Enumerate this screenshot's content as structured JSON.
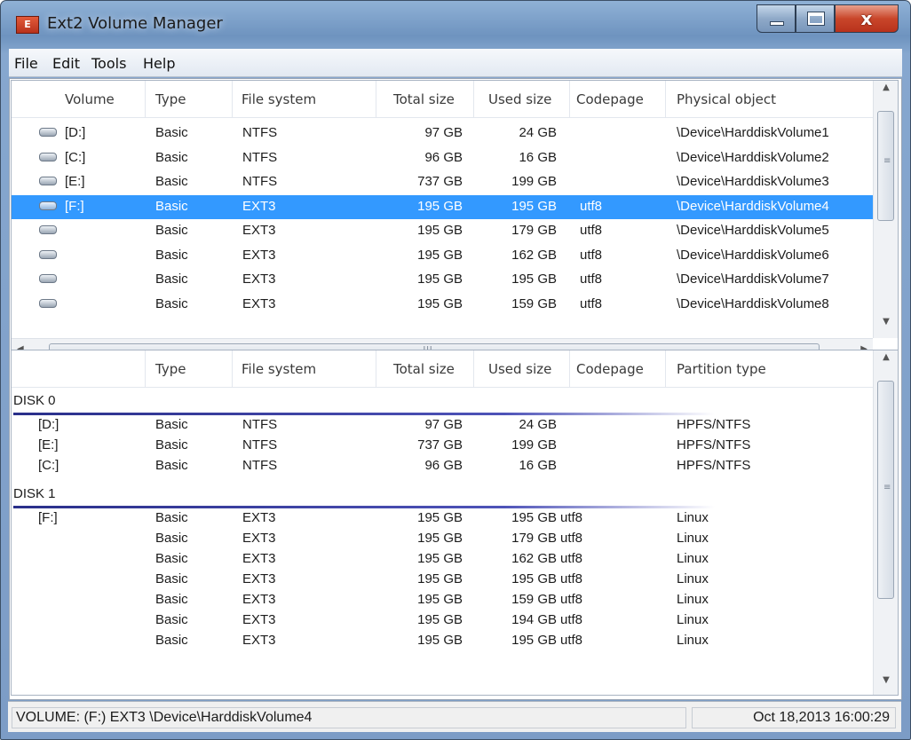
{
  "window": {
    "title": "Ext2 Volume Manager",
    "icon": "ext2-app-icon",
    "buttons": [
      "minimize",
      "maximize",
      "close"
    ],
    "close_glyph": "x"
  },
  "menu": [
    "File",
    "Edit",
    "Tools",
    "Help"
  ],
  "volumes": {
    "headers": [
      "Volume",
      "Type",
      "File system",
      "Total size",
      "Used size",
      "Codepage",
      "Physical object"
    ],
    "rows": [
      {
        "volume": "[D:]",
        "type": "Basic",
        "fs": "NTFS",
        "total": "97 GB",
        "used": "24 GB",
        "codepage": "",
        "physical": "\\Device\\HarddiskVolume1",
        "selected": false
      },
      {
        "volume": "[C:]",
        "type": "Basic",
        "fs": "NTFS",
        "total": "96 GB",
        "used": "16 GB",
        "codepage": "",
        "physical": "\\Device\\HarddiskVolume2",
        "selected": false
      },
      {
        "volume": "[E:]",
        "type": "Basic",
        "fs": "NTFS",
        "total": "737 GB",
        "used": "199 GB",
        "codepage": "",
        "physical": "\\Device\\HarddiskVolume3",
        "selected": false
      },
      {
        "volume": "[F:]",
        "type": "Basic",
        "fs": "EXT3",
        "total": "195 GB",
        "used": "195 GB",
        "codepage": "utf8",
        "physical": "\\Device\\HarddiskVolume4",
        "selected": true
      },
      {
        "volume": "",
        "type": "Basic",
        "fs": "EXT3",
        "total": "195 GB",
        "used": "179 GB",
        "codepage": "utf8",
        "physical": "\\Device\\HarddiskVolume5",
        "selected": false
      },
      {
        "volume": "",
        "type": "Basic",
        "fs": "EXT3",
        "total": "195 GB",
        "used": "162 GB",
        "codepage": "utf8",
        "physical": "\\Device\\HarddiskVolume6",
        "selected": false
      },
      {
        "volume": "",
        "type": "Basic",
        "fs": "EXT3",
        "total": "195 GB",
        "used": "195 GB",
        "codepage": "utf8",
        "physical": "\\Device\\HarddiskVolume7",
        "selected": false
      },
      {
        "volume": "",
        "type": "Basic",
        "fs": "EXT3",
        "total": "195 GB",
        "used": "159 GB",
        "codepage": "utf8",
        "physical": "\\Device\\HarddiskVolume8",
        "selected": false
      }
    ]
  },
  "disks": {
    "headers": [
      "Type",
      "File system",
      "Total size",
      "Used size",
      "Codepage",
      "Partition type"
    ],
    "groups": [
      {
        "label": "DISK 0",
        "rows": [
          {
            "volume": "[D:]",
            "type": "Basic",
            "fs": "NTFS",
            "total": "97 GB",
            "used": "24 GB",
            "codepage": "",
            "partition": "HPFS/NTFS"
          },
          {
            "volume": "[E:]",
            "type": "Basic",
            "fs": "NTFS",
            "total": "737 GB",
            "used": "199 GB",
            "codepage": "",
            "partition": "HPFS/NTFS"
          },
          {
            "volume": "[C:]",
            "type": "Basic",
            "fs": "NTFS",
            "total": "96 GB",
            "used": "16 GB",
            "codepage": "",
            "partition": "HPFS/NTFS"
          }
        ]
      },
      {
        "label": "DISK 1",
        "rows": [
          {
            "volume": "[F:]",
            "type": "Basic",
            "fs": "EXT3",
            "total": "195 GB",
            "used": "195 GB",
            "codepage": "utf8",
            "partition": "Linux"
          },
          {
            "volume": "",
            "type": "Basic",
            "fs": "EXT3",
            "total": "195 GB",
            "used": "179 GB",
            "codepage": "utf8",
            "partition": "Linux"
          },
          {
            "volume": "",
            "type": "Basic",
            "fs": "EXT3",
            "total": "195 GB",
            "used": "162 GB",
            "codepage": "utf8",
            "partition": "Linux"
          },
          {
            "volume": "",
            "type": "Basic",
            "fs": "EXT3",
            "total": "195 GB",
            "used": "195 GB",
            "codepage": "utf8",
            "partition": "Linux"
          },
          {
            "volume": "",
            "type": "Basic",
            "fs": "EXT3",
            "total": "195 GB",
            "used": "159 GB",
            "codepage": "utf8",
            "partition": "Linux"
          },
          {
            "volume": "",
            "type": "Basic",
            "fs": "EXT3",
            "total": "195 GB",
            "used": "194 GB",
            "codepage": "utf8",
            "partition": "Linux"
          },
          {
            "volume": "",
            "type": "Basic",
            "fs": "EXT3",
            "total": "195 GB",
            "used": "195 GB",
            "codepage": "utf8",
            "partition": "Linux"
          }
        ]
      }
    ]
  },
  "status": {
    "left": "VOLUME: (F:) EXT3 \\Device\\HarddiskVolume4",
    "right": "Oct 18,2013 16:00:29"
  },
  "icons": {
    "volume_row": "disk-drive-icon",
    "scroll_up": "scroll-up-arrow-icon",
    "scroll_down": "scroll-down-arrow-icon",
    "scroll_left": "scroll-left-arrow-icon",
    "scroll_right": "scroll-right-arrow-icon"
  },
  "colors": {
    "selection": "#3399ff",
    "disk_line": "#2a2f8a",
    "title_bar": "#6e93bf",
    "close_button": "#c9462a"
  }
}
